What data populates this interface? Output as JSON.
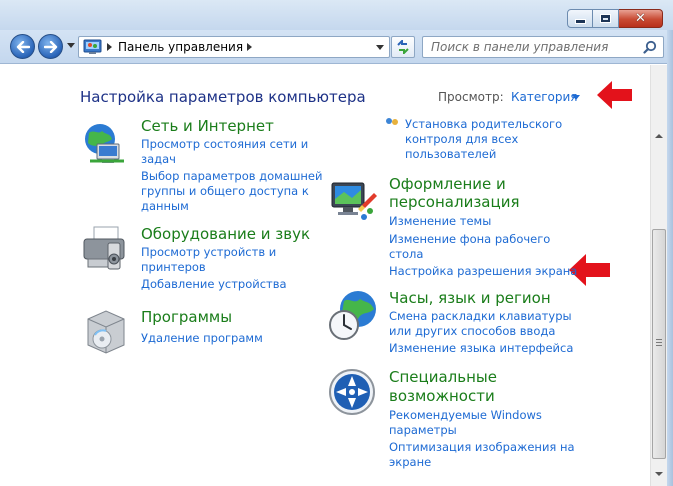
{
  "window": {
    "minimize_glyph": "",
    "maximize_glyph": "",
    "close_glyph": "✕"
  },
  "navigation": {
    "address_path": "Панель управления",
    "search_placeholder": "Поиск в панели управления"
  },
  "header": {
    "title": "Настройка параметров компьютера",
    "view_label": "Просмотр:",
    "view_value": "Категория"
  },
  "categories_left": [
    {
      "title": "Сеть и Интернет",
      "icon": "network-globe-icon",
      "links": [
        "Просмотр состояния сети и",
        "задач",
        "Выбор параметров домашней",
        "группы и общего доступа к",
        "данным"
      ]
    },
    {
      "title": "Оборудование и звук",
      "icon": "printer-icon",
      "links": [
        "Просмотр устройств и",
        "принтеров",
        "Добавление устройства"
      ]
    },
    {
      "title": "Программы",
      "icon": "programs-box-icon",
      "links": [
        "Удаление программ"
      ]
    }
  ],
  "categories_right": [
    {
      "title": "",
      "icon": "parental-controls-icon",
      "links": [
        "Установка родительского",
        "контроля для всех",
        "пользователей"
      ]
    },
    {
      "title_lines": [
        "Оформление и",
        "персонализация"
      ],
      "icon": "monitor-palette-icon",
      "links": [
        "Изменение темы",
        "Изменение фона рабочего",
        "стола",
        "Настройка разрешения экрана"
      ]
    },
    {
      "title": "Часы, язык и регион",
      "icon": "clock-globe-icon",
      "links": [
        "Смена раскладки клавиатуры",
        "или других способов ввода",
        "Изменение языка интерфейса"
      ]
    },
    {
      "title_lines": [
        "Специальные",
        "возможности"
      ],
      "icon": "accessibility-icon",
      "links": [
        "Рекомендуемые Windows",
        "параметры",
        "Оптимизация изображения на",
        "экране"
      ]
    }
  ],
  "colors": {
    "title_blue": "#1e3287",
    "category_green": "#1a7d1a",
    "link_blue": "#1d6ad3",
    "arrow_red": "#e3121b"
  }
}
